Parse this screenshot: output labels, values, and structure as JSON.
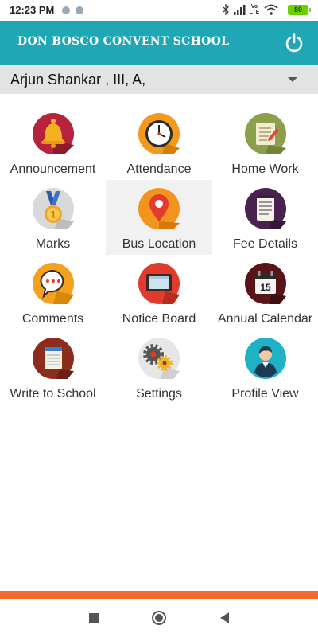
{
  "status_bar": {
    "time": "12:23 PM",
    "network_label": "Vo LTE",
    "battery_level": "80",
    "icons": [
      "notification-dot-icon",
      "notification-dot-icon",
      "bluetooth-icon",
      "signal-icon",
      "wifi-icon",
      "battery-icon"
    ]
  },
  "app_bar": {
    "title": "DON BOSCO CONVENT SCHOOL",
    "power_icon": "power-icon",
    "color": "#1fa7b5"
  },
  "student": {
    "selected": "Arjun Shankar , III, A,"
  },
  "menu": [
    {
      "label": "Announcement",
      "icon": "bell-icon"
    },
    {
      "label": "Attendance",
      "icon": "clock-icon"
    },
    {
      "label": "Home Work",
      "icon": "homework-icon"
    },
    {
      "label": "Marks",
      "icon": "medal-icon"
    },
    {
      "label": "Bus Location",
      "icon": "location-pin-icon"
    },
    {
      "label": "Fee Details",
      "icon": "notepad-icon"
    },
    {
      "label": "Comments",
      "icon": "chat-bubble-icon"
    },
    {
      "label": "Notice Board",
      "icon": "notice-board-icon"
    },
    {
      "label": "Annual Calendar",
      "icon": "calendar-icon"
    },
    {
      "label": "Write to School",
      "icon": "notebook-icon"
    },
    {
      "label": "Settings",
      "icon": "gears-icon"
    },
    {
      "label": "Profile View",
      "icon": "user-profile-icon"
    }
  ],
  "calendar_day": "15",
  "navigation": {
    "icons": [
      "recent-apps-icon",
      "home-icon",
      "back-icon"
    ]
  },
  "colors": {
    "accent": "#1fa7b5",
    "footer_strip": "#f26a2e"
  }
}
